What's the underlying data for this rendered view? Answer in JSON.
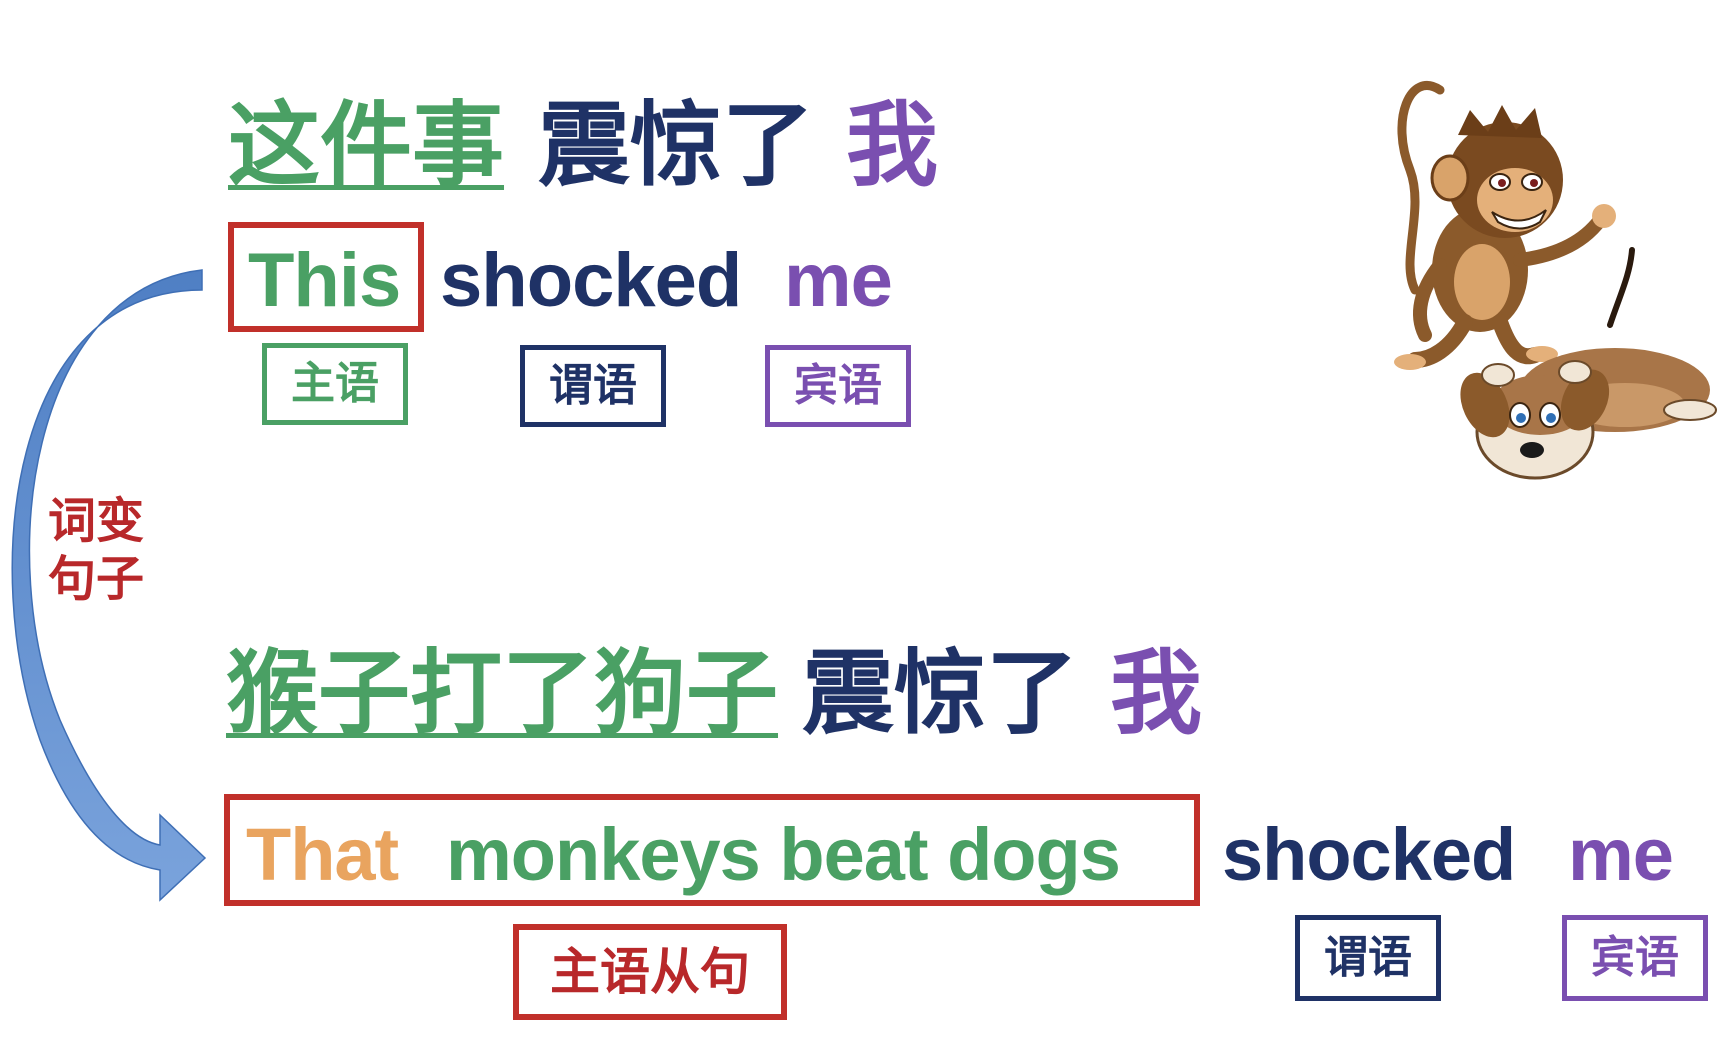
{
  "row1": {
    "cn_subject": "这件事",
    "cn_verb": "震惊了",
    "cn_object": "我",
    "en_subject": "This",
    "en_verb": "shocked",
    "en_object": "me",
    "tag_subject": "主语",
    "tag_verb": "谓语",
    "tag_object": "宾语"
  },
  "side": {
    "line1": "词变",
    "line2": "句子"
  },
  "row2": {
    "cn_subject": "猴子打了狗子",
    "cn_verb": "震惊了",
    "cn_object": "我",
    "en_that": "That",
    "en_clause": "monkeys beat dogs",
    "en_verb": "shocked",
    "en_object": "me",
    "tag_subject_clause": "主语从句",
    "tag_verb": "谓语",
    "tag_object": "宾语"
  },
  "illustration": {
    "monkey": "monkey-illustration",
    "dog": "dog-illustration"
  },
  "colors": {
    "green": "#4aa064",
    "navy": "#1f3266",
    "purple": "#7a4fb0",
    "red": "#b8282a",
    "orange": "#e9a45f",
    "arrow": "#5b87c7"
  }
}
